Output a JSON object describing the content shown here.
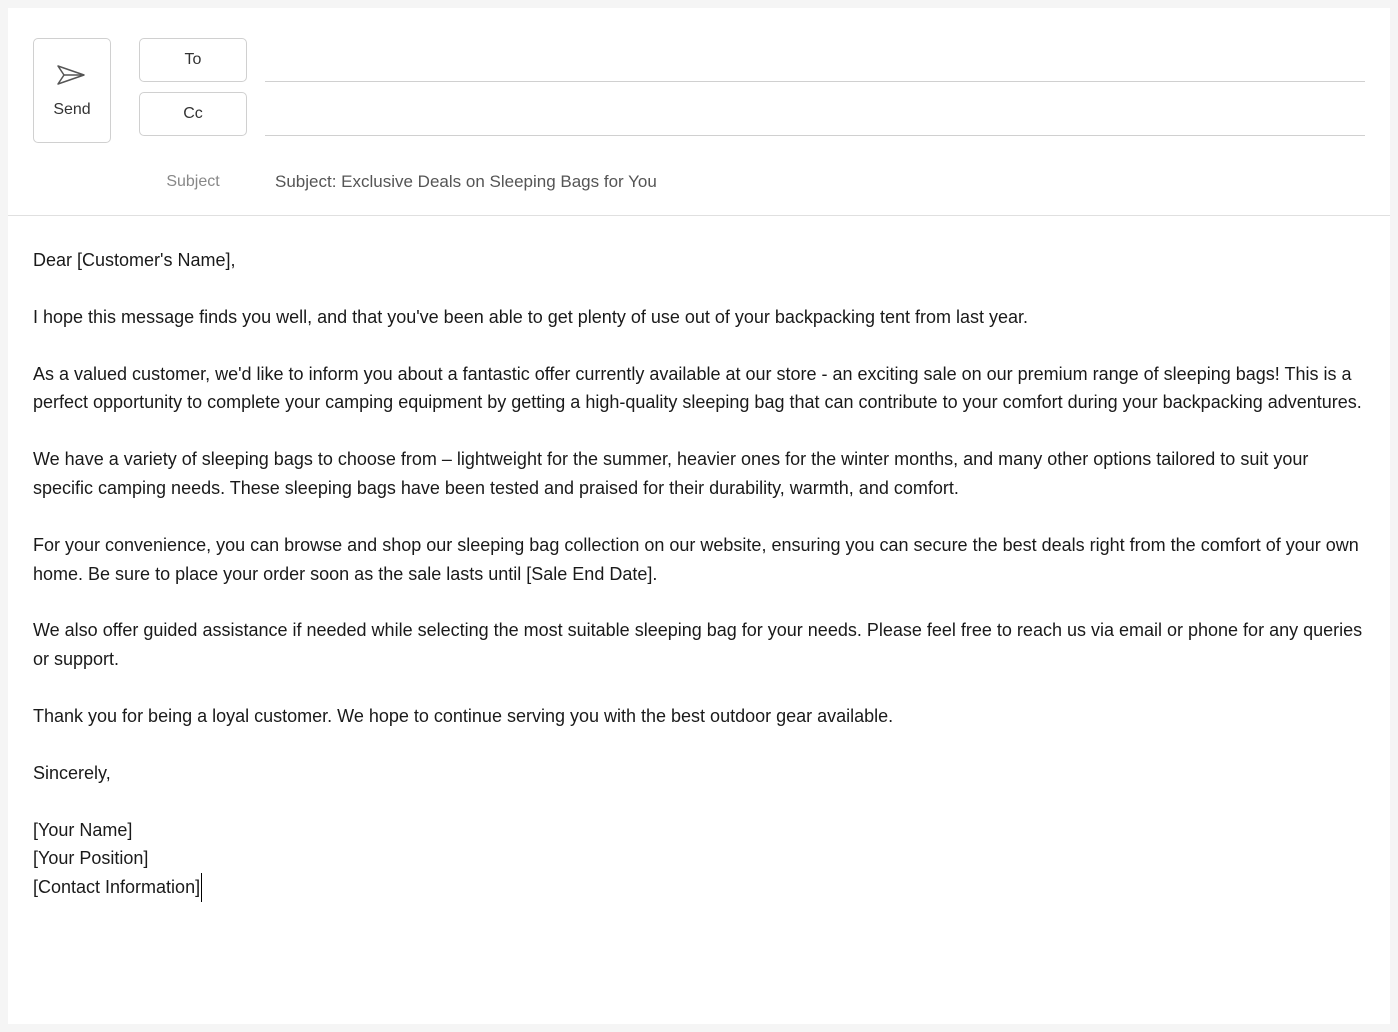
{
  "send": {
    "label": "Send"
  },
  "fields": {
    "to_label": "To",
    "to_value": "",
    "cc_label": "Cc",
    "cc_value": "",
    "subject_label": "Subject",
    "subject_value": "Subject: Exclusive Deals on Sleeping Bags for You"
  },
  "body": {
    "greeting": "Dear [Customer's Name],",
    "p1": "I hope this message finds you well, and that you've been able to get plenty of use out of your backpacking tent from last year.",
    "p2": "As a valued customer, we'd like to inform you about a fantastic offer currently available at our store - an exciting sale on our premium range of sleeping bags! This is a perfect opportunity to complete your camping equipment by getting a high-quality sleeping bag that can contribute to your comfort during your backpacking adventures.",
    "p3": "We have a variety of sleeping bags to choose from – lightweight for the summer, heavier ones for the winter months, and many other options tailored to suit your specific camping needs. These sleeping bags have been tested and praised for their durability, warmth, and comfort.",
    "p4": "For your convenience, you can browse and shop our sleeping bag collection on our website, ensuring you can secure the best deals right from the comfort of your own home. Be sure to place your order soon as the sale lasts until [Sale End Date].",
    "p5": "We also offer guided assistance if needed while selecting the most suitable sleeping bag for your needs. Please feel free to reach us via email or phone for any queries or support.",
    "p6": "Thank you for being a loyal customer. We hope to continue serving you with the best outdoor gear available.",
    "closing": "Sincerely,",
    "sig1": "[Your Name]",
    "sig2": "[Your Position]",
    "sig3": "[Contact Information]"
  }
}
